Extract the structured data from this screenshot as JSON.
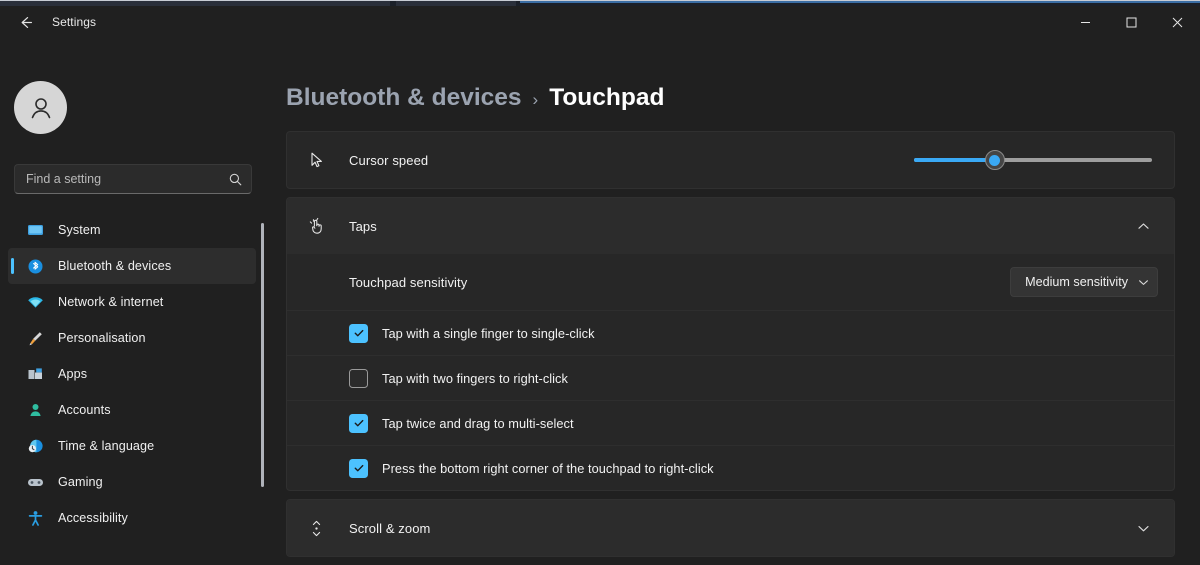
{
  "titlebar": {
    "back_icon": "arrow-left-icon",
    "title": "Settings",
    "minimize_label": "—",
    "maximize_label": "☐",
    "close_label": "✕"
  },
  "sidebar": {
    "avatar_icon": "person-avatar-icon",
    "search": {
      "placeholder": "Find a setting",
      "value": "",
      "icon": "search-icon"
    },
    "items": [
      {
        "label": "System",
        "icon": "monitor-icon",
        "selected": false
      },
      {
        "label": "Bluetooth & devices",
        "icon": "bluetooth-icon",
        "selected": true
      },
      {
        "label": "Network & internet",
        "icon": "wifi-icon",
        "selected": false
      },
      {
        "label": "Personalisation",
        "icon": "paintbrush-icon",
        "selected": false
      },
      {
        "label": "Apps",
        "icon": "apps-icon",
        "selected": false
      },
      {
        "label": "Accounts",
        "icon": "account-icon",
        "selected": false
      },
      {
        "label": "Time & language",
        "icon": "clock-globe-icon",
        "selected": false
      },
      {
        "label": "Gaming",
        "icon": "gamepad-icon",
        "selected": false
      },
      {
        "label": "Accessibility",
        "icon": "accessibility-icon",
        "selected": false
      }
    ]
  },
  "breadcrumb": {
    "parent": "Bluetooth & devices",
    "separator": "›",
    "current": "Touchpad"
  },
  "main": {
    "cursor_speed": {
      "icon": "cursor-arrow-icon",
      "label": "Cursor speed",
      "slider_percent": 34
    },
    "taps": {
      "icon": "tap-hand-icon",
      "label": "Taps",
      "expanded": true,
      "chevron": "chevron-up-icon",
      "sensitivity": {
        "label": "Touchpad sensitivity",
        "value": "Medium sensitivity",
        "caret": "chevron-down-icon"
      },
      "options": [
        {
          "label": "Tap with a single finger to single-click",
          "checked": true
        },
        {
          "label": "Tap with two fingers to right-click",
          "checked": false
        },
        {
          "label": "Tap twice and drag to multi-select",
          "checked": true
        },
        {
          "label": "Press the bottom right corner of the touchpad to right-click",
          "checked": true
        }
      ]
    },
    "scroll_zoom": {
      "icon": "scroll-vertical-icon",
      "label": "Scroll & zoom",
      "expanded": false,
      "chevron": "chevron-down-icon"
    }
  },
  "colors": {
    "accent": "#4cc2ff",
    "slider_fill": "#3aa9f5",
    "window_bg": "#202020",
    "card_bg": "#272727"
  }
}
